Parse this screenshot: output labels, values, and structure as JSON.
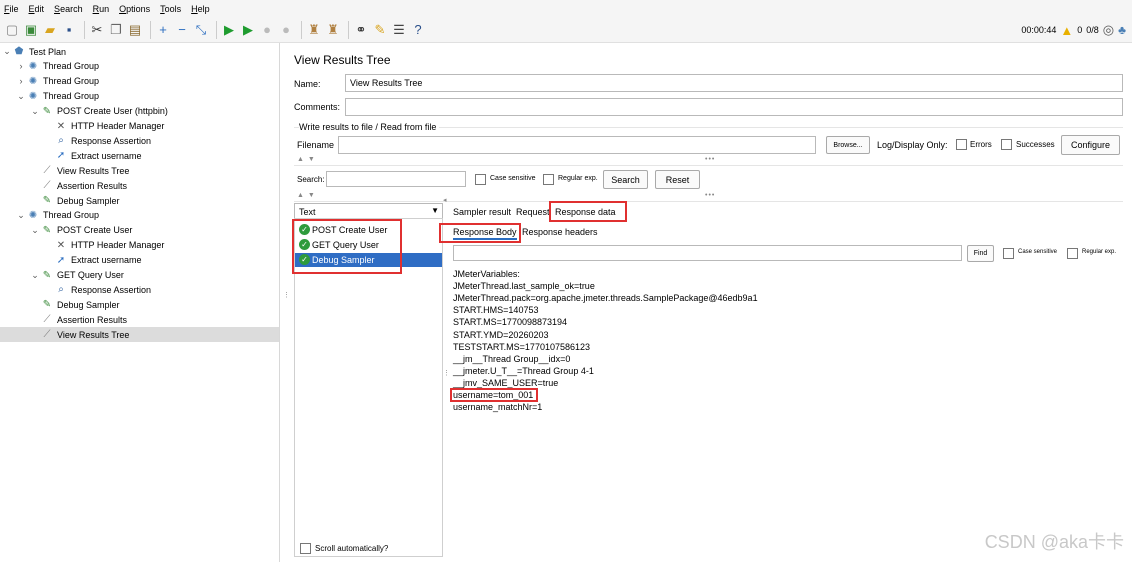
{
  "menu": [
    "File",
    "Edit",
    "Search",
    "Run",
    "Options",
    "Tools",
    "Help"
  ],
  "toolbar": {
    "icons": [
      "new-icon",
      "templates-icon",
      "open-icon",
      "save-icon",
      "cut-icon",
      "copy-icon",
      "paste-icon",
      "expand-icon",
      "collapse-icon",
      "toggle-icon",
      "start-icon",
      "start-no-pause-icon",
      "stop-icon",
      "shutdown-icon",
      "clear-icon",
      "clear-all-icon",
      "search-icon",
      "reset-search-icon",
      "function-helper-icon",
      "help-icon"
    ],
    "timer": "00:00:44",
    "warnings": "0",
    "threads": "0/8"
  },
  "tree": [
    {
      "label": "Test Plan",
      "icon": "test-plan-icon",
      "arrow": "open"
    },
    {
      "label": "Thread Group",
      "icon": "gear-icon",
      "arrow": "closed"
    },
    {
      "label": "Thread Group",
      "icon": "gear-icon",
      "arrow": "closed"
    },
    {
      "label": "Thread Group",
      "icon": "gear-icon",
      "arrow": "open"
    },
    {
      "label": "POST Create User (httpbin)",
      "icon": "pen-icon",
      "arrow": "open"
    },
    {
      "label": "HTTP Header Manager",
      "icon": "wrench-icon",
      "arrow": ""
    },
    {
      "label": "Response Assertion",
      "icon": "magnifier-icon",
      "arrow": ""
    },
    {
      "label": "Extract username",
      "icon": "extractor-icon",
      "arrow": ""
    },
    {
      "label": "View Results Tree",
      "icon": "listener-icon",
      "arrow": ""
    },
    {
      "label": "Assertion Results",
      "icon": "listener-icon",
      "arrow": ""
    },
    {
      "label": "Debug Sampler",
      "icon": "pen-icon",
      "arrow": ""
    },
    {
      "label": "Thread Group",
      "icon": "gear-icon",
      "arrow": "open"
    },
    {
      "label": "POST Create User",
      "icon": "pen-icon",
      "arrow": "open"
    },
    {
      "label": "HTTP Header Manager",
      "icon": "wrench-icon",
      "arrow": ""
    },
    {
      "label": "Extract username",
      "icon": "extractor-icon",
      "arrow": ""
    },
    {
      "label": "GET Query User",
      "icon": "pen-icon",
      "arrow": "open"
    },
    {
      "label": "Response Assertion",
      "icon": "magnifier-icon",
      "arrow": ""
    },
    {
      "label": "Debug Sampler",
      "icon": "pen-icon",
      "arrow": ""
    },
    {
      "label": "Assertion Results",
      "icon": "listener-icon",
      "arrow": ""
    },
    {
      "label": "View Results Tree",
      "icon": "listener-icon",
      "arrow": "",
      "selected": true
    }
  ],
  "panel": {
    "title": "View Results Tree",
    "name_label": "Name:",
    "name_value": "View Results Tree",
    "comments_label": "Comments:",
    "comments_value": "",
    "write_section": "Write results to file / Read from file",
    "filename_label": "Filename",
    "filename_value": "",
    "browse": "Browse...",
    "log_display": "Log/Display Only:",
    "errors": "Errors",
    "successes": "Successes",
    "configure": "Configure",
    "search_label": "Search:",
    "search_value": "",
    "case_sensitive": "Case sensitive",
    "regular_exp": "Regular exp.",
    "search_btn": "Search",
    "reset_btn": "Reset",
    "renderer": "Text",
    "results": [
      "POST Create User",
      "GET Query User",
      "Debug Sampler"
    ],
    "tabs": [
      "Sampler result",
      "Request",
      "Response data"
    ],
    "subtabs": [
      "Response Body",
      "Response headers"
    ],
    "find_btn": "Find",
    "find_case": "Case sensitive",
    "find_regex": "Regular exp.",
    "scroll_auto": "Scroll automatically?",
    "response_lines": [
      "JMeterVariables:",
      "JMeterThread.last_sample_ok=true",
      "JMeterThread.pack=org.apache.jmeter.threads.SamplePackage@46edb9a1",
      "START.HMS=140753",
      "START.MS=1770098873194",
      "START.YMD=20260203",
      "TESTSTART.MS=1770107586123",
      "__jm__Thread Group__idx=0",
      "__jmeter.U_T__=Thread Group 4-1",
      "__jmv_SAME_USER=true",
      "username=tom_001",
      "username_matchNr=1"
    ]
  },
  "watermark": "CSDN @aka卡卡"
}
